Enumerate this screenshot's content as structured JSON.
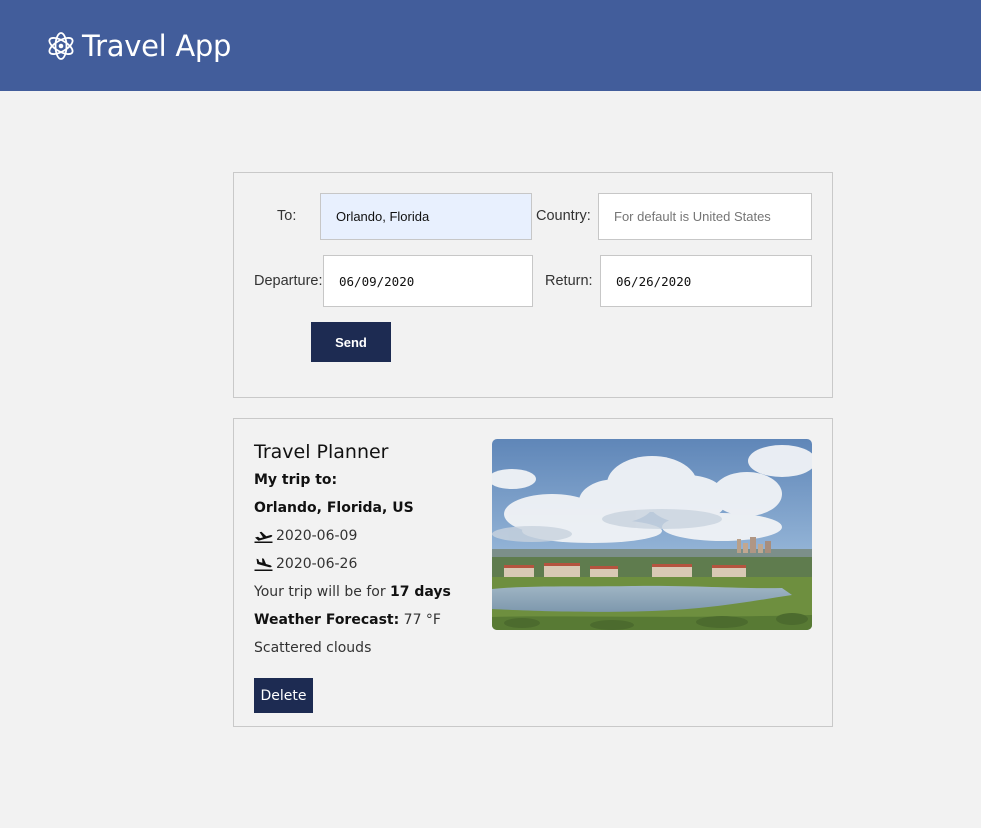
{
  "header": {
    "title": "Travel App",
    "logo_icon": "atom-logo-icon",
    "background": "#425d9b"
  },
  "form": {
    "to_label": "To:",
    "to_value": "Orlando, Florida",
    "country_label": "Country:",
    "country_placeholder": "For default is United States",
    "departure_label": "Departure:",
    "departure_value": "06/09/2020",
    "return_label": "Return:",
    "return_value": "06/26/2020",
    "send_label": "Send"
  },
  "planner": {
    "title": "Travel Planner",
    "trip_to_label": "My trip to:",
    "destination": "Orlando, Florida, US",
    "departure_date": "2020-06-09",
    "return_date": "2020-06-26",
    "duration_prefix": "Your trip will be for",
    "duration_value": "17 days",
    "weather_label": "Weather Forecast:",
    "weather_value": "77 °F",
    "weather_description": "Scattered clouds",
    "delete_label": "Delete",
    "departure_icon": "plane-takeoff-icon",
    "arrival_icon": "plane-landing-icon"
  },
  "colors": {
    "button": "#1d2b52",
    "autofill": "#e8f0fe",
    "background": "#f2f2f2"
  }
}
